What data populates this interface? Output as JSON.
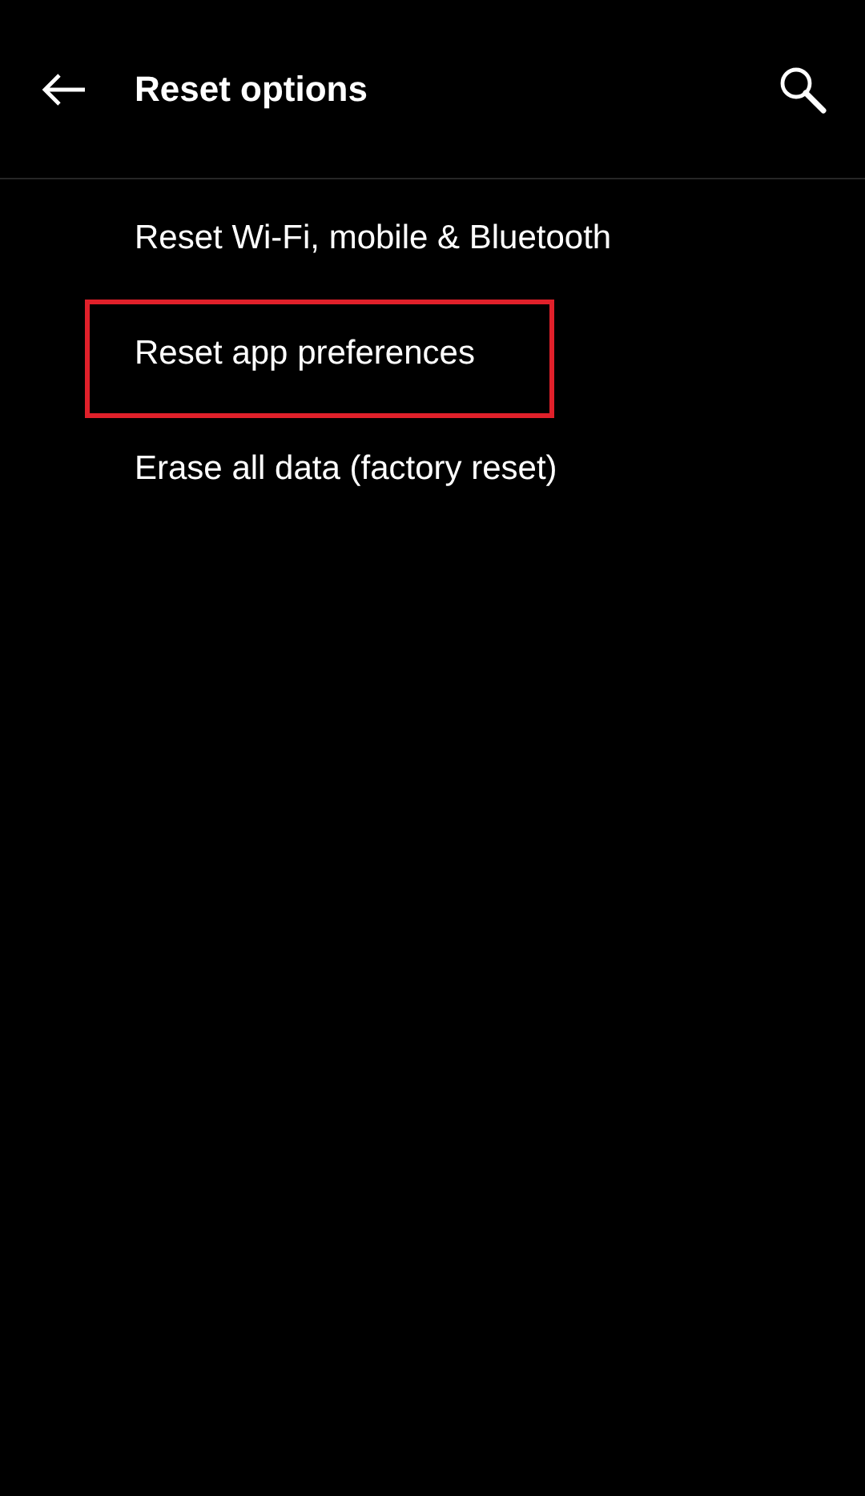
{
  "app_bar": {
    "title": "Reset options"
  },
  "items": [
    {
      "label": "Reset Wi-Fi, mobile & Bluetooth",
      "highlighted": false
    },
    {
      "label": "Reset app preferences",
      "highlighted": true
    },
    {
      "label": "Erase all data (factory reset)",
      "highlighted": false
    }
  ]
}
